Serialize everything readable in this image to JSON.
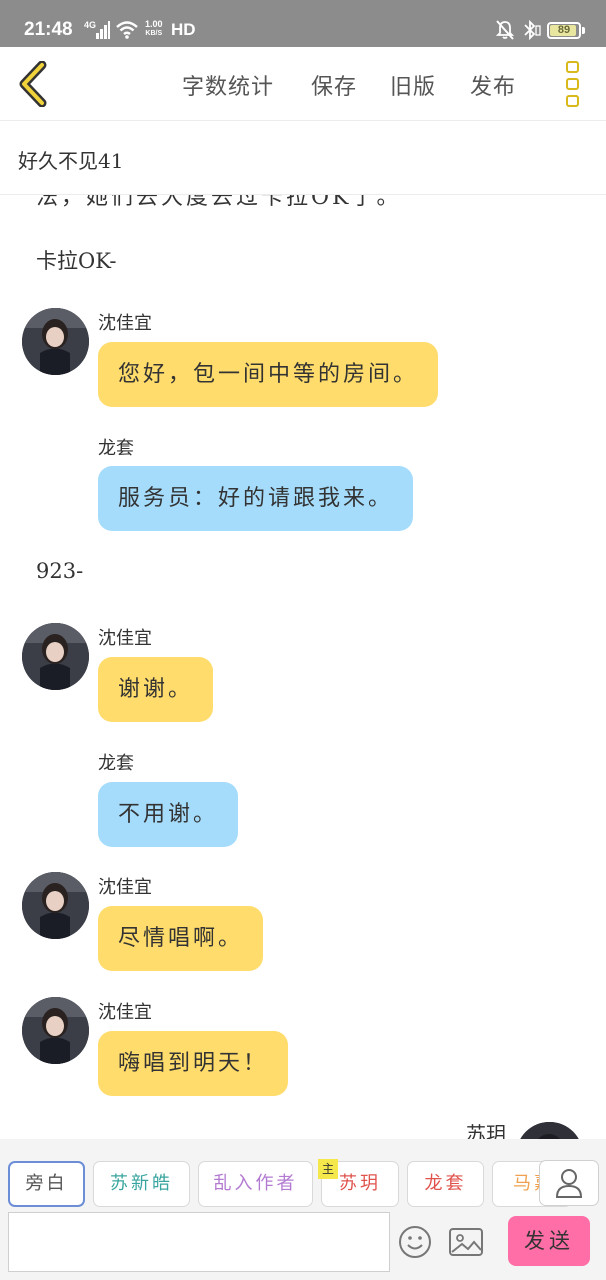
{
  "status_bar": {
    "time": "21:48",
    "network": "4G",
    "speed_value": "1.00",
    "speed_unit": "KB/S",
    "hd": "HD",
    "battery": "89",
    "icons": [
      "signal-icon",
      "wifi-icon",
      "mute-icon",
      "bluetooth-icon",
      "battery-icon"
    ]
  },
  "toolbar": {
    "back_icon": "chevron-left-icon",
    "word_count_label": "字数统计",
    "save_label": "保存",
    "old_version_label": "旧版",
    "publish_label": "发布",
    "more_icon": "more-vertical-icon",
    "accent_color": "#d8b919"
  },
  "title": "好久不见41",
  "chat": {
    "partial_top_line": "法，她们去大度去过卡拉OK了。",
    "messages": [
      {
        "type": "narration",
        "text": "卡拉OK-"
      },
      {
        "type": "speech",
        "sender": "沈佳宜",
        "text": "您好，包一间中等的房间。",
        "color": "yellow"
      },
      {
        "type": "speech",
        "sender": "龙套",
        "text": "服务员：好的请跟我来。",
        "color": "blue"
      },
      {
        "type": "narration",
        "text": "923-"
      },
      {
        "type": "speech",
        "sender": "沈佳宜",
        "text": "谢谢。",
        "color": "yellow"
      },
      {
        "type": "speech",
        "sender": "龙套",
        "text": "不用谢。",
        "color": "blue"
      },
      {
        "type": "speech",
        "sender": "沈佳宜",
        "text": "尽情唱啊。",
        "color": "yellow"
      },
      {
        "type": "speech",
        "sender": "沈佳宜",
        "text": "嗨唱到明天！",
        "color": "yellow"
      }
    ],
    "partial_sender_right": "苏玥",
    "bubble_colors": {
      "yellow": "#ffdc6b",
      "blue": "#a5dcfb"
    }
  },
  "roles": {
    "chips": [
      {
        "label": "旁白",
        "color": "#555555",
        "selected": true
      },
      {
        "label": "苏新皓",
        "color": "#3aa5a0",
        "selected": false
      },
      {
        "label": "乱入作者",
        "color": "#b37ad1",
        "selected": false
      },
      {
        "label": "苏玥",
        "color": "#e0534d",
        "selected": false,
        "owner": true
      },
      {
        "label": "龙套",
        "color": "#e0534d",
        "selected": false
      },
      {
        "label": "马嘉祺",
        "color": "#f0a050",
        "selected": false
      }
    ],
    "owner_badge": "主",
    "person_icon": "person-icon"
  },
  "composer": {
    "input_value": "",
    "input_placeholder": "",
    "emoji_icon": "smile-icon",
    "image_icon": "image-icon",
    "send_label": "发送",
    "send_color": "#ff6ea6"
  }
}
